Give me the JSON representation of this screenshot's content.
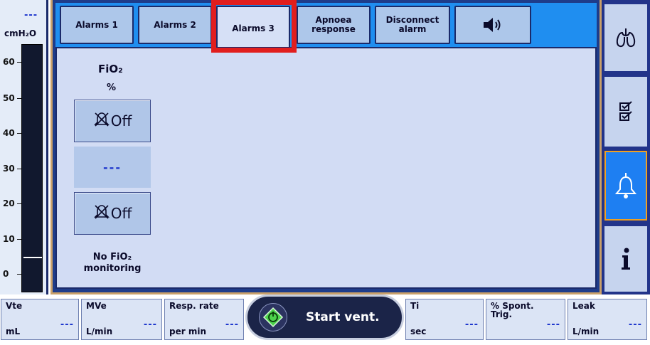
{
  "gauge": {
    "value": "---",
    "unit": "cmH₂O",
    "ticks": [
      "60",
      "50",
      "40",
      "30",
      "20",
      "10",
      "0"
    ]
  },
  "tabs": [
    {
      "label": "Alarms 1"
    },
    {
      "label": "Alarms 2"
    },
    {
      "label": "Alarms 3",
      "active": true
    },
    {
      "label": "Apnoea response"
    },
    {
      "label": "Disconnect alarm"
    },
    {
      "label": "",
      "icon": "speaker-icon"
    }
  ],
  "fio2": {
    "title": "FiO₂",
    "unit": "%",
    "upper_limit": "Off",
    "current_value": "---",
    "lower_limit": "Off",
    "note": "No FiO₂ monitoring",
    "limit_icon": "alarm-off-icon"
  },
  "sidebar": [
    {
      "icon": "lungs-icon"
    },
    {
      "icon": "checklist-icon"
    },
    {
      "icon": "bell-icon",
      "active": true
    },
    {
      "icon": "info-icon"
    }
  ],
  "bottom": {
    "cells": [
      {
        "name": "Vte",
        "unit": "mL",
        "value": "---"
      },
      {
        "name": "MVe",
        "unit": "L/min",
        "value": "---"
      },
      {
        "name": "Resp. rate",
        "unit": "per min",
        "value": "---"
      },
      {
        "name": "Ti",
        "unit": "sec",
        "value": "---"
      },
      {
        "name": "% Spont. Trig.",
        "unit": "",
        "value": "---"
      },
      {
        "name": "Leak",
        "unit": "L/min",
        "value": "---"
      }
    ],
    "start_button": {
      "label": "Start vent.",
      "icon": "start-icon"
    }
  },
  "colors": {
    "accent_blue": "#1f8ef0",
    "frame_dark": "#1e3c8a",
    "highlight_red": "#e11e1e",
    "active_border": "#f0a020",
    "value_blue": "#1a33cc"
  }
}
